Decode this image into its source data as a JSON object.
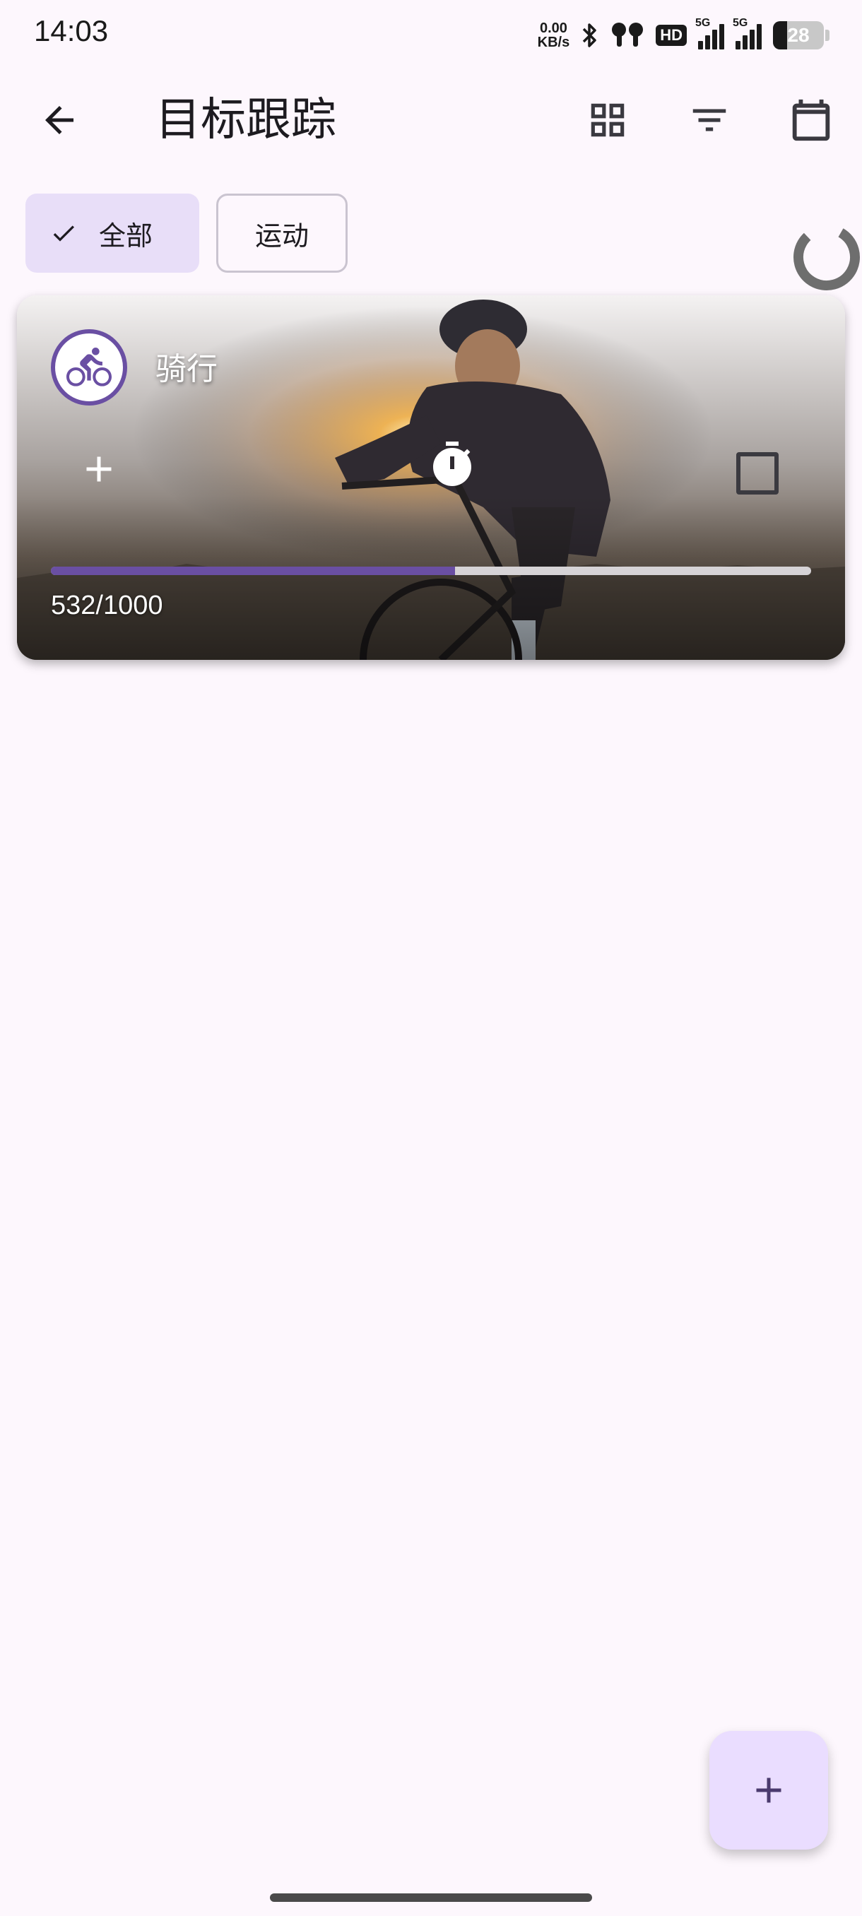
{
  "status_bar": {
    "time": "14:03",
    "net_speed_value": "0.00",
    "net_speed_unit": "KB/s",
    "hd_label": "HD",
    "signal_1_label": "5G",
    "signal_2_label": "5G",
    "battery_level": "28"
  },
  "app_bar": {
    "back_icon": "arrow-back-icon",
    "title": "目标跟踪",
    "grid_icon": "grid-view-icon",
    "filter_icon": "filter-list-icon",
    "calendar_icon": "calendar-icon"
  },
  "filter_chips": [
    {
      "label": "全部",
      "selected": true,
      "icon": "check-icon"
    },
    {
      "label": "运动",
      "selected": false
    }
  ],
  "goals": [
    {
      "title": "骑行",
      "icon": "bike-icon",
      "current": 532,
      "target": 1000,
      "progress_label": "532/1000",
      "progress_fraction": 0.532,
      "actions": [
        "add-icon",
        "timer-icon",
        "checkbox"
      ]
    }
  ],
  "fab": {
    "icon": "add-icon"
  },
  "colors": {
    "background": "#fdf7fd",
    "accent": "#6a4fa3",
    "chip_selected": "#e8def8",
    "fab": "#eaddff"
  }
}
